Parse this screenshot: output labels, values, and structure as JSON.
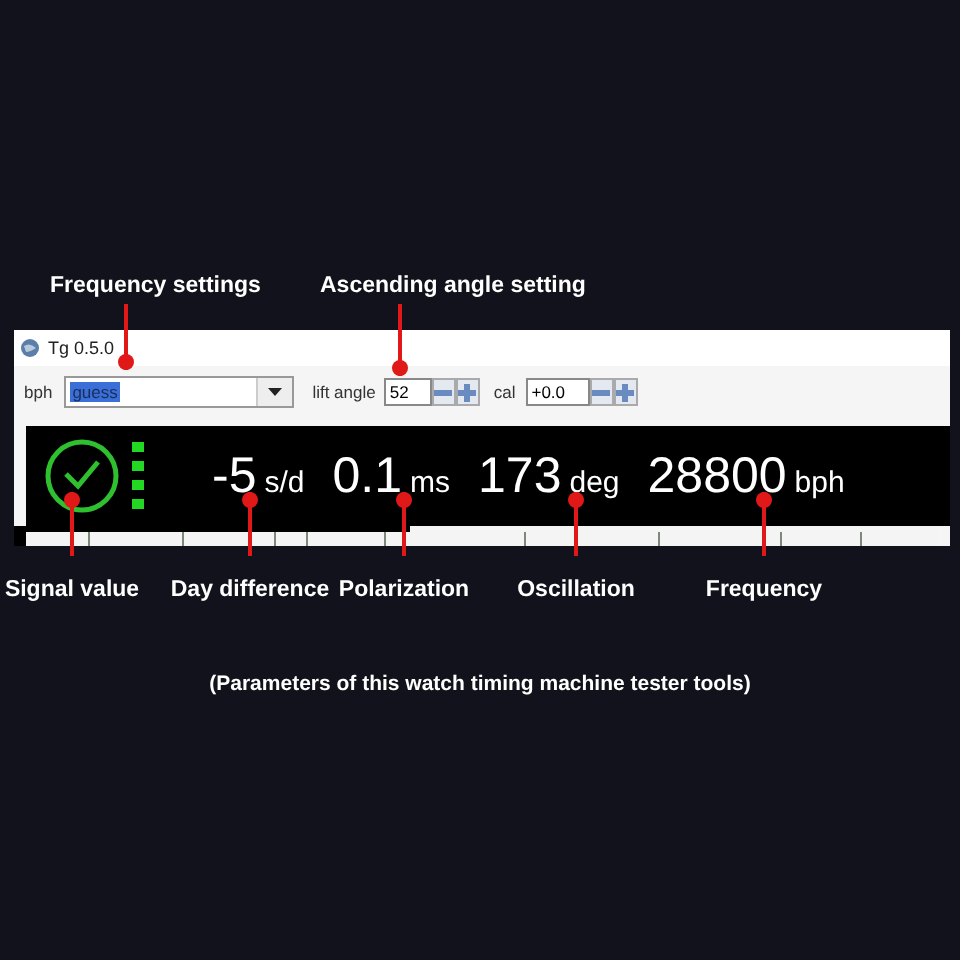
{
  "top_annotations": [
    {
      "label": "Frequency settings"
    },
    {
      "label": "Ascending angle setting"
    }
  ],
  "window": {
    "title": "Tg 0.5.0",
    "toolbar": {
      "bph_label": "bph",
      "bph_value": "guess",
      "lift_angle_label": "lift angle",
      "lift_angle_value": "52",
      "cal_label": "cal",
      "cal_value": "+0.0"
    },
    "readings": [
      {
        "value": "-5",
        "unit": "s/d"
      },
      {
        "value": "0.1",
        "unit": "ms"
      },
      {
        "value": "173",
        "unit": "deg"
      },
      {
        "value": "28800",
        "unit": "bph"
      }
    ]
  },
  "bottom_annotations": [
    {
      "label": "Signal value"
    },
    {
      "label": "Day difference"
    },
    {
      "label": "Polarization"
    },
    {
      "label": "Oscillation"
    },
    {
      "label": "Frequency"
    }
  ],
  "caption": "(Parameters of this watch timing machine tester tools)"
}
